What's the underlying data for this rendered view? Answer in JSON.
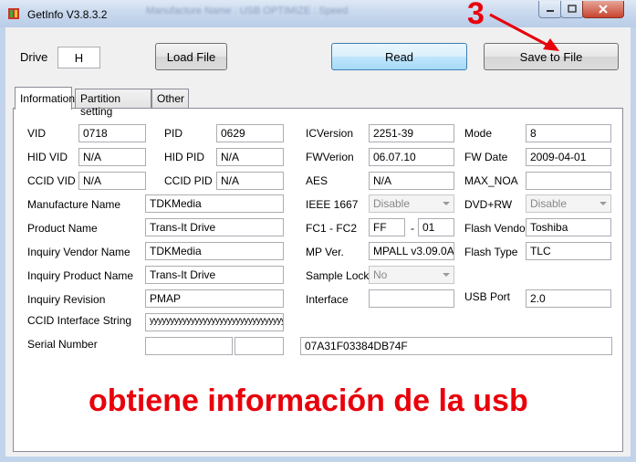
{
  "window": {
    "title": "GetInfo V3.8.3.2",
    "title_blurred": "Manufacture Name : USB          OPTIMIZE : Speed"
  },
  "toolbar": {
    "drive_label": "Drive",
    "drive_value": "H",
    "load_label": "Load File",
    "read_label": "Read",
    "save_label": "Save to File"
  },
  "tabs": [
    {
      "label": "Information",
      "active": true
    },
    {
      "label": "Partition setting",
      "active": false
    },
    {
      "label": "Other",
      "active": false
    }
  ],
  "info": {
    "vid": {
      "label": "VID",
      "value": "0718"
    },
    "pid": {
      "label": "PID",
      "value": "0629"
    },
    "icversion": {
      "label": "ICVersion",
      "value": "2251-39"
    },
    "mode": {
      "label": "Mode",
      "value": "8"
    },
    "hid_vid": {
      "label": "HID VID",
      "value": "N/A"
    },
    "hid_pid": {
      "label": "HID PID",
      "value": "N/A"
    },
    "fwversion": {
      "label": "FWVerion",
      "value": "06.07.10"
    },
    "fw_date": {
      "label": "FW Date",
      "value": "2009-04-01"
    },
    "ccid_vid": {
      "label": "CCID VID",
      "value": "N/A"
    },
    "ccid_pid": {
      "label": "CCID PID",
      "value": "N/A"
    },
    "aes": {
      "label": "AES",
      "value": "N/A"
    },
    "max_noa": {
      "label": "MAX_NOA",
      "value": ""
    },
    "manufacture_name": {
      "label": "Manufacture Name",
      "value": "TDKMedia"
    },
    "ieee1667": {
      "label": "IEEE 1667",
      "value": "Disable"
    },
    "dvd_rw": {
      "label": "DVD+RW",
      "value": "Disable"
    },
    "product_name": {
      "label": "Product Name",
      "value": "Trans-It Drive"
    },
    "fc": {
      "label": "FC1 - FC2",
      "fc1": "FF",
      "dash": "-",
      "fc2": "01"
    },
    "flash_vendor": {
      "label": "Flash Vendor",
      "value": "Toshiba"
    },
    "inquiry_vendor": {
      "label": "Inquiry Vendor Name",
      "value": "TDKMedia"
    },
    "mp_ver": {
      "label": "MP Ver.",
      "value": "MPALL v3.09.0A"
    },
    "flash_type": {
      "label": "Flash Type",
      "value": "TLC"
    },
    "inquiry_product": {
      "label": "Inquiry Product Name",
      "value": "Trans-It Drive"
    },
    "sample_lock": {
      "label": "Sample Lock",
      "value": "No"
    },
    "inquiry_revision": {
      "label": "Inquiry Revision",
      "value": "PMAP"
    },
    "interface": {
      "label": "Interface",
      "value": ""
    },
    "usb_port": {
      "label": "USB Port",
      "value": "2.0"
    },
    "ccid_interface": {
      "label": "CCID Interface String",
      "value": "yyyyyyyyyyyyyyyyyyyyyyyyyyyyyyyyyyyyyyyyyy"
    },
    "serial_number": {
      "label": "Serial Number",
      "value": "07A31F03384DB74F"
    }
  },
  "annotation": {
    "step": "3",
    "caption": "obtiene información de la usb",
    "color": "#e8000b"
  }
}
